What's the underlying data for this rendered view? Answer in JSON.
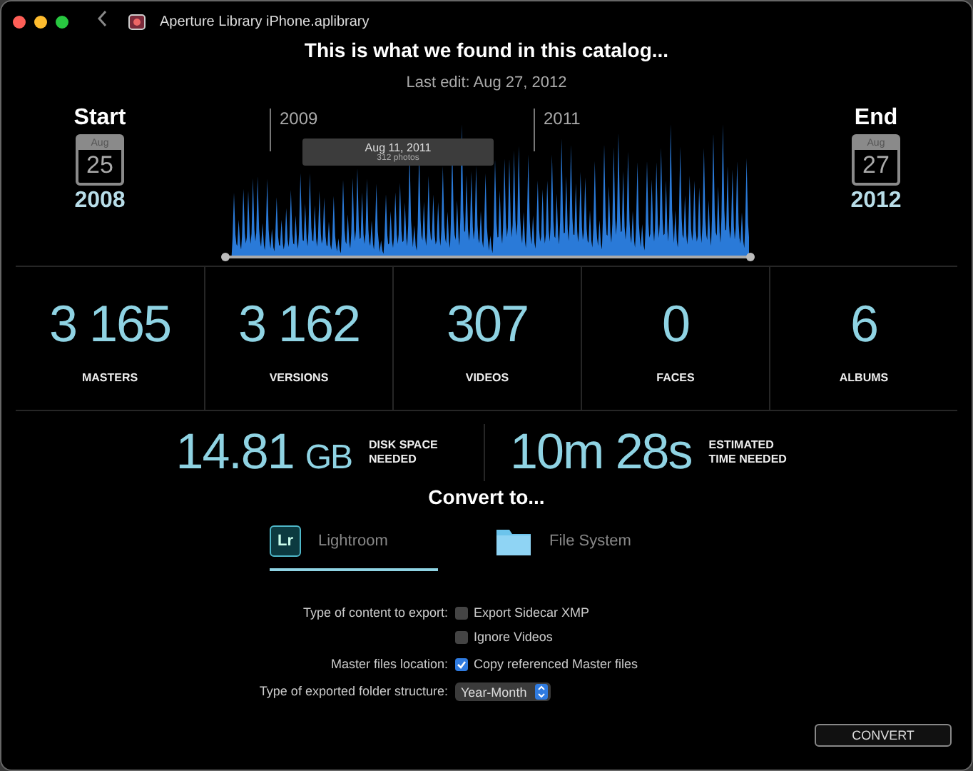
{
  "window": {
    "title": "Aperture Library iPhone.aplibrary"
  },
  "heading": "This is what we found in this catalog...",
  "last_edit": "Last edit: Aug 27, 2012",
  "start": {
    "label": "Start",
    "month": "Aug",
    "day": "25",
    "year": "2008"
  },
  "end": {
    "label": "End",
    "month": "Aug",
    "day": "27",
    "year": "2012"
  },
  "timeline": {
    "year_marks": [
      "2009",
      "2011"
    ],
    "tooltip": {
      "date": "Aug 11, 2011",
      "count": "312 photos"
    }
  },
  "stats": [
    {
      "value": "3 165",
      "label": "MASTERS"
    },
    {
      "value": "3 162",
      "label": "VERSIONS"
    },
    {
      "value": "307",
      "label": "VIDEOS"
    },
    {
      "value": "0",
      "label": "FACES"
    },
    {
      "value": "6",
      "label": "ALBUMS"
    }
  ],
  "totals": [
    {
      "value": "14.81",
      "unit": "GB",
      "label": "DISK SPACE NEEDED"
    },
    {
      "value": "10m 28s",
      "label": "ESTIMATED TIME NEEDED"
    }
  ],
  "convert_heading": "Convert to...",
  "targets": [
    {
      "kind": "lightroom",
      "icon_text": "Lr",
      "label": "Lightroom",
      "selected": true
    },
    {
      "kind": "folder",
      "label": "File System",
      "selected": false
    }
  ],
  "options": [
    {
      "kind": "checkbox",
      "label": "Type of content to export:",
      "choices": [
        {
          "label": "Export Sidecar XMP",
          "checked": false
        },
        {
          "label": "Ignore Videos",
          "checked": false
        }
      ]
    },
    {
      "kind": "checkbox",
      "label": "Master files location:",
      "choices": [
        {
          "label": "Copy referenced Master files",
          "checked": true
        }
      ]
    },
    {
      "kind": "popup",
      "label": "Type of exported folder structure:",
      "value": "Year-Month"
    }
  ],
  "convert_button": "CONVERT"
}
